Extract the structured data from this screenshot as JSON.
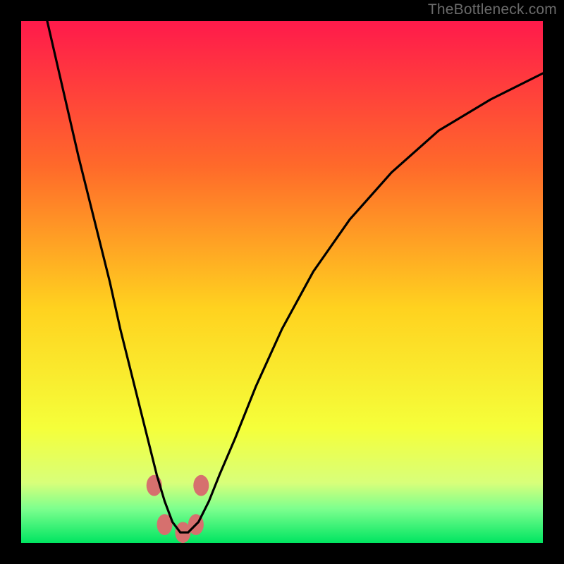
{
  "watermark": "TheBottleneck.com",
  "chart_data": {
    "type": "line",
    "title": "",
    "xlabel": "",
    "ylabel": "",
    "xlim": [
      0,
      100
    ],
    "ylim": [
      0,
      100
    ],
    "background_gradient": {
      "stops": [
        {
          "offset": 0.0,
          "color": "#ff1a4b"
        },
        {
          "offset": 0.28,
          "color": "#ff6a2a"
        },
        {
          "offset": 0.55,
          "color": "#ffd21f"
        },
        {
          "offset": 0.78,
          "color": "#f5ff3a"
        },
        {
          "offset": 0.885,
          "color": "#d8ff7a"
        },
        {
          "offset": 0.935,
          "color": "#7cff8e"
        },
        {
          "offset": 1.0,
          "color": "#00e561"
        }
      ]
    },
    "series": [
      {
        "name": "bottleneck-curve",
        "color": "#000000",
        "x": [
          5,
          8,
          11,
          14,
          17,
          19,
          21,
          23,
          24.5,
          26,
          27.5,
          29,
          30.5,
          32,
          34,
          36,
          38,
          41,
          45,
          50,
          56,
          63,
          71,
          80,
          90,
          100
        ],
        "y": [
          100,
          87,
          74,
          62,
          50,
          41,
          33,
          25,
          19,
          13,
          8,
          4,
          2,
          2,
          4,
          8,
          13,
          20,
          30,
          41,
          52,
          62,
          71,
          79,
          85,
          90
        ]
      }
    ],
    "markers": [
      {
        "x": 25.5,
        "y": 11.0,
        "color": "#d6706e"
      },
      {
        "x": 27.5,
        "y": 3.5,
        "color": "#d6706e"
      },
      {
        "x": 31.0,
        "y": 2.0,
        "color": "#d6706e"
      },
      {
        "x": 33.5,
        "y": 3.5,
        "color": "#d6706e"
      },
      {
        "x": 34.5,
        "y": 11.0,
        "color": "#d6706e"
      }
    ],
    "marker_radius_px": 11
  }
}
